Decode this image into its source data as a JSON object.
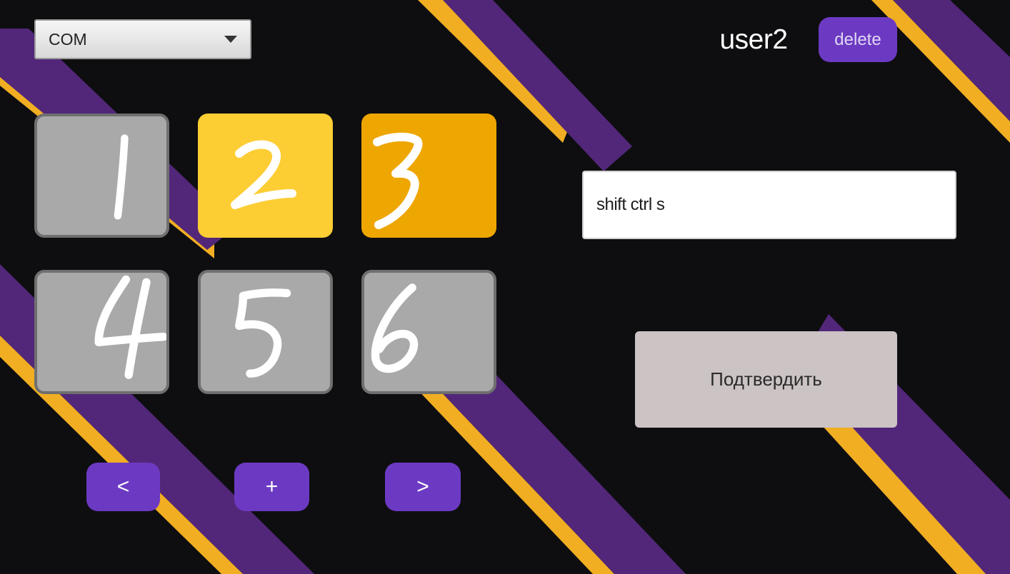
{
  "port_select": {
    "value": "COM",
    "options": [
      "COM"
    ]
  },
  "user": {
    "name": "user2",
    "delete_label": "delete"
  },
  "slots": [
    {
      "digit": "1",
      "state": "inactive"
    },
    {
      "digit": "2",
      "state": "selected"
    },
    {
      "digit": "3",
      "state": "highlighted"
    },
    {
      "digit": "4",
      "state": "inactive"
    },
    {
      "digit": "5",
      "state": "inactive"
    },
    {
      "digit": "6",
      "state": "inactive"
    }
  ],
  "nav": {
    "prev_label": "<",
    "add_label": "+",
    "next_label": ">"
  },
  "hotkey": {
    "value": "shift ctrl s"
  },
  "confirm": {
    "label": "Подтвердить"
  },
  "colors": {
    "background": "#0e0e10",
    "stripe_purple": "#52277a",
    "stripe_yellow": "#f1ae22",
    "accent_button": "#6c3ac2",
    "slot_inactive": "#a9a9a9",
    "slot_selected": "#fdcd34",
    "slot_highlighted": "#eea600",
    "confirm_button": "#cbc3c4"
  }
}
